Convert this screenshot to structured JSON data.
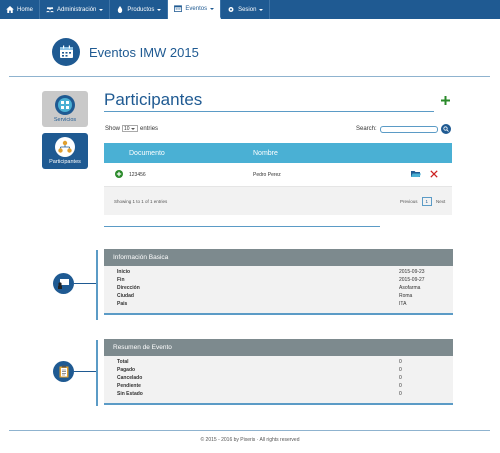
{
  "nav": {
    "items": [
      {
        "label": "Home",
        "icon": "home-icon",
        "dropdown": false,
        "active": false
      },
      {
        "label": "Administración",
        "icon": "users-icon",
        "dropdown": true,
        "active": false
      },
      {
        "label": "Productos",
        "icon": "drop-icon",
        "dropdown": true,
        "active": false
      },
      {
        "label": "Eventos",
        "icon": "calendar-icon",
        "dropdown": true,
        "active": true
      },
      {
        "label": "Sesion",
        "icon": "gear-icon",
        "dropdown": true,
        "active": false
      }
    ]
  },
  "header": {
    "title": "Eventos IMW 2015",
    "icon": "calendar-icon"
  },
  "sidebar": {
    "tiles": [
      {
        "label": "Servicios",
        "icon": "globe-grid-icon",
        "active": false
      },
      {
        "label": "Participantes",
        "icon": "org-chart-icon",
        "active": true
      }
    ]
  },
  "participants": {
    "title": "Participantes",
    "show_label": "Show",
    "entries_value": "10",
    "entries_label": "entries",
    "search_label": "Search:",
    "search_value": "",
    "columns": [
      "Documento",
      "Nombre"
    ],
    "rows": [
      {
        "documento": "123456",
        "nombre": "Pedro Perez"
      }
    ],
    "showing_text": "Showing 1 to 1 of 1 entries",
    "pagination": {
      "previous": "Previous",
      "current": "1",
      "next": "Next"
    }
  },
  "info_basica": {
    "title": "Información Basica",
    "icon": "presenter-icon",
    "fields": [
      {
        "label": "Inicio",
        "value": "2015-09-23"
      },
      {
        "label": "Fin",
        "value": "2015-09-27"
      },
      {
        "label": "Dirección",
        "value": "Asofarma"
      },
      {
        "label": "Ciudad",
        "value": "Roma"
      },
      {
        "label": "Pais",
        "value": "ITA"
      }
    ]
  },
  "resumen": {
    "title": "Resumen de Evento",
    "icon": "clipboard-icon",
    "fields": [
      {
        "label": "Total",
        "value": "0"
      },
      {
        "label": "Pagado",
        "value": "0"
      },
      {
        "label": "Cancelado",
        "value": "0"
      },
      {
        "label": "Pendiente",
        "value": "0"
      },
      {
        "label": "Sin Estado",
        "value": "0"
      }
    ]
  },
  "footer": {
    "text": "© 2015 - 2016 by Pixeris · All rights reserved"
  },
  "colors": {
    "primary": "#1f5a92",
    "table_header": "#4ab0d4",
    "panel_header": "#7d8a8e",
    "add": "#2a8a2a",
    "delete": "#cc2222"
  }
}
